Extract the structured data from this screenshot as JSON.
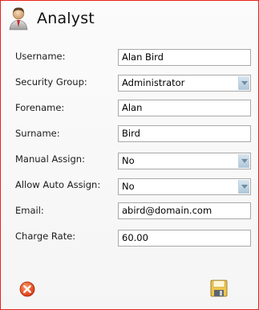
{
  "header": {
    "title": "Analyst",
    "icon": "user-icon"
  },
  "fields": {
    "username": {
      "label": "Username:",
      "value": "Alan Bird"
    },
    "security_group": {
      "label": "Security Group:",
      "value": "Administrator"
    },
    "forename": {
      "label": "Forename:",
      "value": "Alan"
    },
    "surname": {
      "label": "Surname:",
      "value": "Bird"
    },
    "manual_assign": {
      "label": "Manual Assign:",
      "value": "No"
    },
    "auto_assign": {
      "label": "Allow Auto Assign:",
      "value": "No"
    },
    "email": {
      "label": "Email:",
      "value": "abird@domain.com"
    },
    "charge_rate": {
      "label": "Charge Rate:",
      "value": "60.00"
    }
  },
  "buttons": {
    "cancel_icon": "close-icon",
    "save_icon": "save-icon"
  },
  "colors": {
    "border": "#e8221c",
    "cancel": "#e8501f",
    "save": "#f0c54a"
  }
}
